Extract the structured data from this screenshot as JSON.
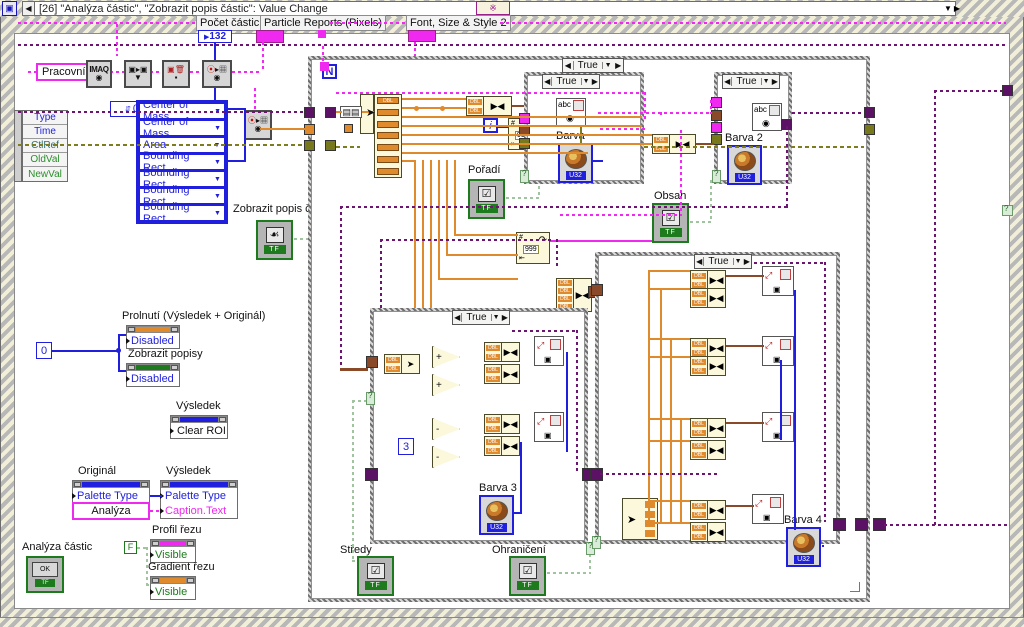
{
  "window": {
    "title": "[26] \"Analýza částic\", \"Zobrazit popis částic\": Value Change",
    "icon_name": "event-structure-icon",
    "frame_btn_label": "※",
    "left_arrow": "◀",
    "right_arrow": "▶",
    "down_arrow": "▼"
  },
  "top_labels": {
    "particle_count": "Počet částic",
    "particle_reports": "Particle Reports (Pixels)",
    "font_style": "Font, Size & Style 2"
  },
  "terminals": {
    "count_value": "132",
    "working_image": "Pracovní",
    "zero_a": "0",
    "zero_b": "0",
    "three": "3",
    "f_const": "F"
  },
  "event_cluster": {
    "rows": [
      "Type",
      "Time",
      "CtlRef",
      "OldVal",
      "NewVal"
    ]
  },
  "imaq_nodes": [
    {
      "name": "imaq-node-1",
      "label": "IMAQ"
    },
    {
      "name": "imaq-node-2",
      "label": ""
    },
    {
      "name": "imaq-node-3",
      "label": ""
    },
    {
      "name": "imaq-node-4",
      "label": ""
    },
    {
      "name": "imaq-node-5",
      "label": ""
    }
  ],
  "measurement_rings": [
    "Center of Mass",
    "Center of Mass",
    "Area",
    "Bounding Rect",
    "Bounding Rect",
    "Bounding Rect",
    "Bounding Rect"
  ],
  "case_selectors": [
    {
      "name": "case-outer",
      "value": "True"
    },
    {
      "name": "case-barva",
      "value": "True"
    },
    {
      "name": "case-barva-2",
      "value": "True"
    },
    {
      "name": "case-barva-3",
      "value": "True"
    },
    {
      "name": "case-barva-4",
      "value": "True"
    }
  ],
  "booleans": [
    {
      "name": "show-particle-caption",
      "label": "Zobrazit popis částic"
    },
    {
      "name": "order",
      "label": "Pořadí"
    },
    {
      "name": "content",
      "label": "Obsah"
    },
    {
      "name": "centers",
      "label": "Středy"
    },
    {
      "name": "bounds",
      "label": "Ohraničení"
    }
  ],
  "picture_controls": [
    {
      "name": "color-1",
      "label": "Barva"
    },
    {
      "name": "color-2",
      "label": "Barva 2"
    },
    {
      "name": "color-3",
      "label": "Barva 3"
    },
    {
      "name": "color-4",
      "label": "Barva 4"
    }
  ],
  "property_nodes": [
    {
      "name": "blend-property",
      "title": "Prolnutí (Výsledek + Originál)",
      "bar_color": "#e08a2e",
      "rows": [
        {
          "text": "Disabled",
          "color": "#1f1fdd"
        }
      ]
    },
    {
      "name": "show-captions-property",
      "title": "Zobrazit popisy",
      "bar_color": "#1d7a1d",
      "rows": [
        {
          "text": "Disabled",
          "color": "#1f1fdd"
        }
      ]
    },
    {
      "name": "result-clear-roi-property",
      "title": "Výsledek",
      "bar_color": "#1f1fdd",
      "rows": [
        {
          "text": "Clear ROI",
          "color": "#111111"
        }
      ]
    },
    {
      "name": "original-palette-property",
      "title": "Originál",
      "bar_color": "#1f1fdd",
      "rows": [
        {
          "text": "Palette Type",
          "color": "#1f1fdd"
        }
      ]
    },
    {
      "name": "result-palette-property",
      "title": "Výsledek",
      "bar_color": "#1f1fdd",
      "rows": [
        {
          "text": "Palette Type",
          "color": "#1f1fdd"
        },
        {
          "text": "Caption.Text",
          "color": "#ef29ef"
        }
      ]
    },
    {
      "name": "cut-profile-property",
      "title": "Profil řezu",
      "bar_color": "#ef29ef",
      "rows": [
        {
          "text": "Visible",
          "color": "#1d7a1d"
        }
      ]
    },
    {
      "name": "cut-gradient-property",
      "title": "Gradient řezu",
      "bar_color": "#e08a2e",
      "rows": [
        {
          "text": "Visible",
          "color": "#1d7a1d"
        }
      ]
    }
  ],
  "misc_labels": {
    "analysis": "Analýza",
    "particle_analysis_button": "Analýza částic",
    "ok_label": "OK"
  },
  "colors": {
    "wire_orange": "#e08a2e",
    "wire_blue": "#1f1fdd",
    "wire_magenta": "#ef29ef",
    "wire_brown": "#8a4a2a",
    "wire_purple": "#6b1470",
    "wire_olive": "#7d7d1f",
    "structure_border": "#6f6f6f",
    "boolean_green": "#1d7a1d"
  }
}
